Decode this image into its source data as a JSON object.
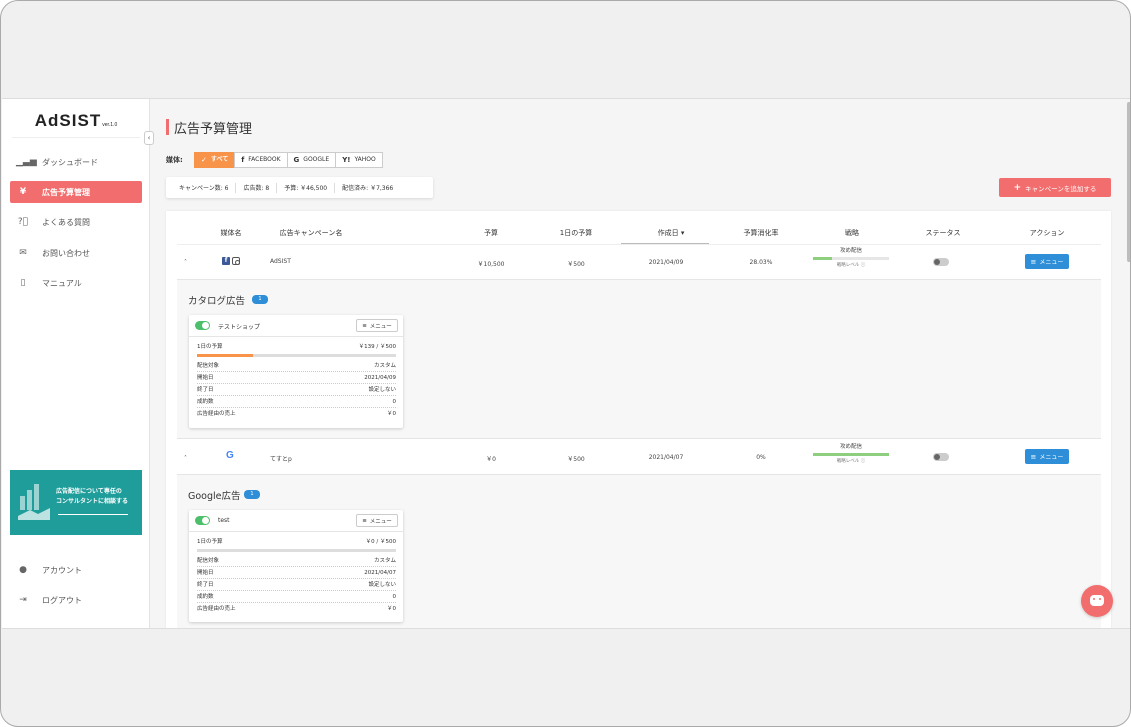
{
  "app": {
    "logo": "AdSIST",
    "version": "ver.1.0"
  },
  "sidebar": {
    "items": [
      {
        "label": "ダッシュボード",
        "icon": "bar-chart-icon"
      },
      {
        "label": "広告予算管理",
        "icon": "yen-icon",
        "active": true
      },
      {
        "label": "よくある質問",
        "icon": "question-icon"
      },
      {
        "label": "お問い合わせ",
        "icon": "mail-icon"
      },
      {
        "label": "マニュアル",
        "icon": "pdf-icon"
      }
    ],
    "banner": {
      "line1": "広告配信について専任の",
      "line2": "コンサルタントに相談する"
    },
    "bottom": [
      {
        "label": "アカウント",
        "icon": "user-circle-icon"
      },
      {
        "label": "ログアウト",
        "icon": "logout-icon"
      }
    ]
  },
  "page": {
    "title": "広告予算管理"
  },
  "media": {
    "label": "媒体:",
    "buttons": [
      {
        "label": "すべて",
        "active": true
      },
      {
        "label": "FACEBOOK"
      },
      {
        "label": "GOOGLE"
      },
      {
        "label": "YAHOO"
      }
    ]
  },
  "stats": {
    "campaigns": "キャンペーン数: 6",
    "ads": "広告数: 8",
    "budget": "予算: ￥46,500",
    "spent": "配信済み: ￥7,366"
  },
  "add_button": "キャンペーンを追加する",
  "table": {
    "headers": [
      "媒体名",
      "広告キャンペーン名",
      "予算",
      "1日の予算",
      "作成日",
      "予算消化率",
      "戦略",
      "ステータス",
      "アクション"
    ],
    "rows": [
      {
        "media": "facebook-instagram",
        "name": "AdSIST",
        "budget": "￥10,500",
        "daily": "￥500",
        "created": "2021/04/09",
        "rate": "28.03%",
        "strategy": "攻め配信",
        "strategy_level_label": "戦略レベル ⓘ",
        "strategy_level": 0.25,
        "menu": "メニュー",
        "sub": {
          "title": "カタログ広告",
          "count": "1",
          "card": {
            "name": "テストショップ",
            "menu": "メニュー",
            "daily_label": "1日の予算",
            "daily_value": "￥139 / ￥500",
            "daily_ratio": 0.28,
            "rows": [
              {
                "k": "配信対象",
                "v": "カスタム"
              },
              {
                "k": "開始日",
                "v": "2021/04/09"
              },
              {
                "k": "終了日",
                "v": "設定しない"
              },
              {
                "k": "成約数",
                "v": "0"
              },
              {
                "k": "広告経由の売上",
                "v": "￥0"
              }
            ]
          }
        }
      },
      {
        "media": "google",
        "name": "てすとp",
        "budget": "￥0",
        "daily": "￥500",
        "created": "2021/04/07",
        "rate": "0%",
        "strategy": "攻め配信",
        "strategy_level_label": "戦略レベル ⓘ",
        "strategy_level": 1.0,
        "menu": "メニュー",
        "sub": {
          "title": "Google広告",
          "count": "1",
          "card": {
            "name": "test",
            "menu": "メニュー",
            "daily_label": "1日の予算",
            "daily_value": "￥0 / ￥500",
            "daily_ratio": 0,
            "rows": [
              {
                "k": "配信対象",
                "v": "カスタム"
              },
              {
                "k": "開始日",
                "v": "2021/04/07"
              },
              {
                "k": "終了日",
                "v": "設定しない"
              },
              {
                "k": "成約数",
                "v": "0"
              },
              {
                "k": "広告経由の売上",
                "v": "￥0"
              }
            ]
          }
        }
      }
    ]
  },
  "colors": {
    "accent": "#f26d6d",
    "orange": "#f7944a",
    "blue": "#2e8fd8",
    "green": "#4cbf6a",
    "teal": "#1f9d9a"
  }
}
